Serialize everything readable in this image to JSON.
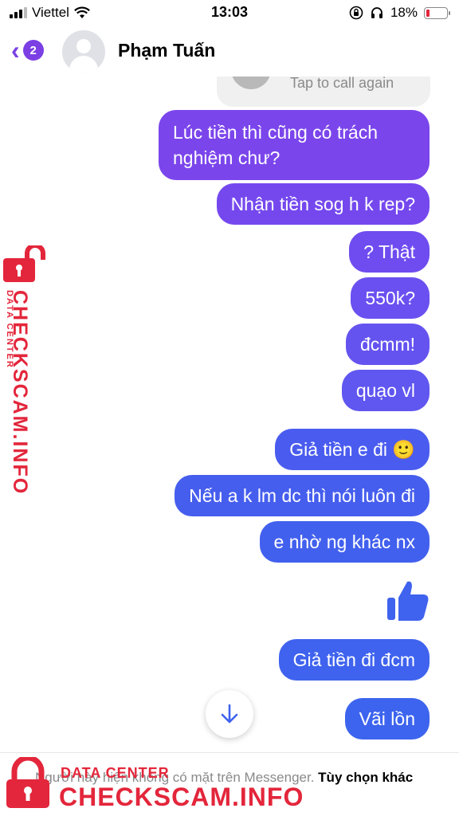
{
  "status_bar": {
    "carrier": "Viettel",
    "time": "13:03",
    "battery": "18%",
    "icons": [
      "signal-icon",
      "wifi-icon",
      "orientation-lock-icon",
      "headphones-icon",
      "battery-icon"
    ]
  },
  "header": {
    "back_badge": "2",
    "contact_name": "Phạm Tuấn"
  },
  "call_card": {
    "text": "Tap to call again"
  },
  "messages": [
    {
      "line1": "Lúc tiền thì cũng có trách",
      "line2": "nghiệm chư?"
    },
    {
      "text": "Nhận tiền sog h k rep?"
    },
    {
      "text": "? Thật"
    },
    {
      "text": "550k?"
    },
    {
      "text": "đcmm!"
    },
    {
      "text": "quạo vl"
    },
    {
      "text": "Giả tiền e đi 🙂"
    },
    {
      "text": "Nếu a k lm dc thì nói luôn đi"
    },
    {
      "text": "e nhờ ng khác nx"
    },
    {
      "text": "Giả tiền đi đcm"
    },
    {
      "text": "Vãi lồn"
    }
  ],
  "footer": {
    "notice": "Người này hiện không có mặt trên Messenger.",
    "link": "Tùy chọn khác"
  },
  "watermark": {
    "small": "DATA CENTER",
    "big": "CHECKSCAM.INFO"
  },
  "colors": {
    "purple": "#7b3fe4",
    "blue": "#3f63ee",
    "watermark_red": "#e3263b"
  }
}
